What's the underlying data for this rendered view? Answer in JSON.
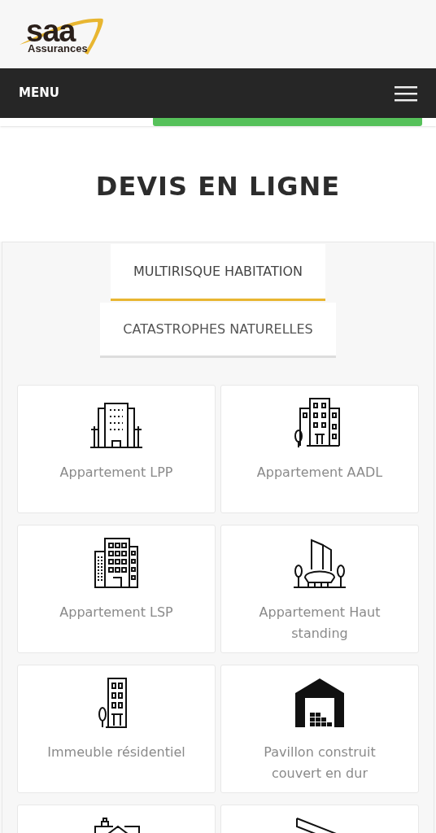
{
  "header": {
    "logo": {
      "wordmark": "saa",
      "tagline": "Assurances"
    }
  },
  "nav": {
    "label": "MENU"
  },
  "title": "DEVIS EN LIGNE",
  "tabs": [
    {
      "label": "MULTIRISQUE HABITATION",
      "selected": true
    },
    {
      "label": "CATASTROPHES NATURELLES",
      "selected": false
    }
  ],
  "cards": [
    {
      "label": "Appartement LPP"
    },
    {
      "label": "Appartement AADL"
    },
    {
      "label": "Appartement LSP"
    },
    {
      "label": "Appartement Haut standing"
    },
    {
      "label": "Immeuble résidentiel"
    },
    {
      "label": "Pavillon construit couvert en dur"
    }
  ]
}
